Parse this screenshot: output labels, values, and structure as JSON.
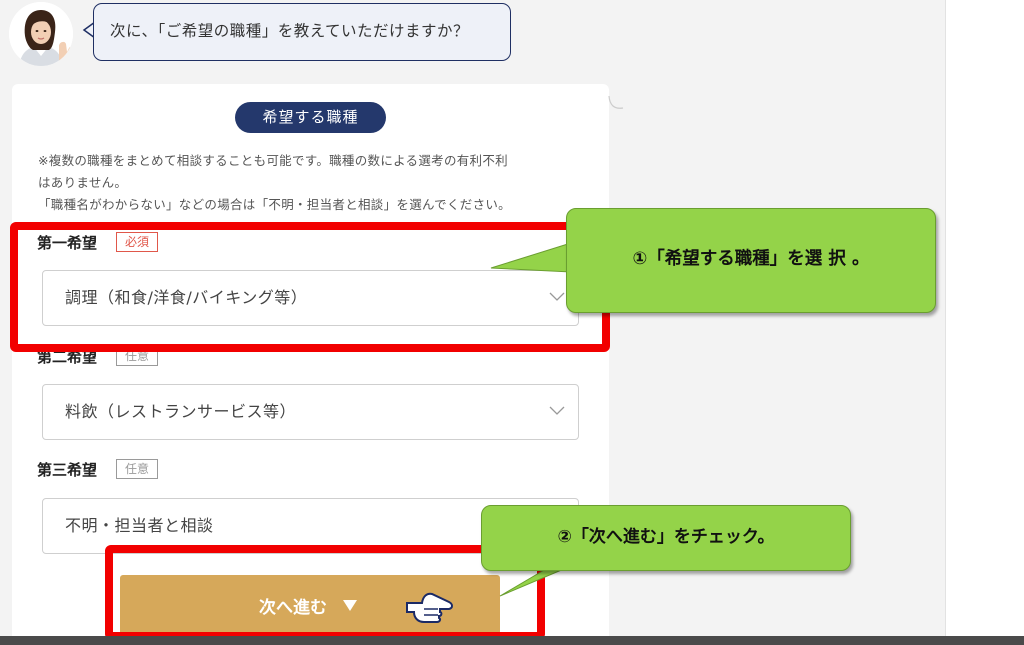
{
  "chat": {
    "question": "次に、「ご希望の職種」を教えていただけますか？"
  },
  "form": {
    "section_title": "希望する職種",
    "note_line1": "※複数の職種をまとめて相談することも可能です。職種の数による選考の有利不利",
    "note_line2": "はありません。",
    "note_line3": "「職種名がわからない」などの場合は「不明・担当者と相談」を選んでください。",
    "fields": [
      {
        "label": "第一希望",
        "badge": "必須",
        "value": "調理（和食/洋食/バイキング等）"
      },
      {
        "label": "第二希望",
        "badge": "任意",
        "value": "料飲（レストランサービス等）"
      },
      {
        "label": "第三希望",
        "badge": "任意",
        "value": "不明・担当者と相談"
      }
    ],
    "next_button": "次へ進む"
  },
  "annotations": {
    "step1": "①「希望する職種」を選 択 。",
    "step2": "②「次へ進む」をチェック。"
  },
  "colors": {
    "navy": "#24386c",
    "required_red": "#e0574a",
    "button_gold": "#d6a85a",
    "highlight_red": "#f20000",
    "callout_green": "#94d349"
  },
  "icons": {
    "dropdown": "chevron-down-icon",
    "button_arrow": "triangle-down-icon",
    "pointer": "pointing-hand-icon",
    "avatar": "assistant-avatar"
  }
}
